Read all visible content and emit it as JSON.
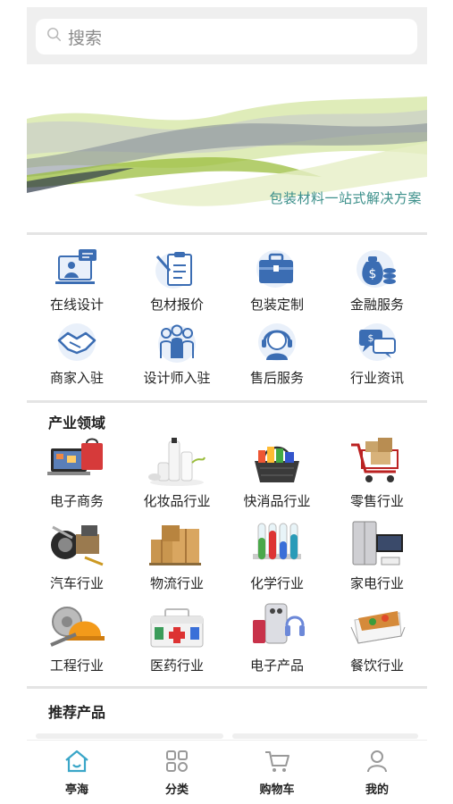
{
  "search": {
    "placeholder": "搜索",
    "icon": "search-icon"
  },
  "banner": {
    "tagline": "包装材料一站式解决方案"
  },
  "services": [
    {
      "label": "在线设计",
      "icon": "online-design-icon"
    },
    {
      "label": "包材报价",
      "icon": "quote-clipboard-icon"
    },
    {
      "label": "包装定制",
      "icon": "briefcase-icon"
    },
    {
      "label": "金融服务",
      "icon": "money-bag-icon"
    },
    {
      "label": "商家入驻",
      "icon": "handshake-icon"
    },
    {
      "label": "设计师入驻",
      "icon": "team-icon"
    },
    {
      "label": "售后服务",
      "icon": "headset-support-icon"
    },
    {
      "label": "行业资讯",
      "icon": "chat-bubbles-icon"
    }
  ],
  "industry": {
    "title": "产业领域",
    "items": [
      {
        "label": "电子商务",
        "icon": "ecommerce-image"
      },
      {
        "label": "化妆品行业",
        "icon": "cosmetics-image"
      },
      {
        "label": "快消品行业",
        "icon": "grocery-basket-image"
      },
      {
        "label": "零售行业",
        "icon": "shopping-cart-image"
      },
      {
        "label": "汽车行业",
        "icon": "auto-parts-image"
      },
      {
        "label": "物流行业",
        "icon": "cardboard-boxes-image"
      },
      {
        "label": "化学行业",
        "icon": "test-tubes-image"
      },
      {
        "label": "家电行业",
        "icon": "refrigerator-image"
      },
      {
        "label": "工程行业",
        "icon": "hard-hat-image"
      },
      {
        "label": "医药行业",
        "icon": "medical-kit-image"
      },
      {
        "label": "电子产品",
        "icon": "electronics-image"
      },
      {
        "label": "餐饮行业",
        "icon": "food-container-image"
      }
    ]
  },
  "recommended": {
    "title": "推荐产品"
  },
  "tabbar": [
    {
      "label": "亭海",
      "icon": "home-icon",
      "active": true
    },
    {
      "label": "分类",
      "icon": "category-grid-icon",
      "active": false
    },
    {
      "label": "购物车",
      "icon": "cart-icon",
      "active": false
    },
    {
      "label": "我的",
      "icon": "profile-icon",
      "active": false
    }
  ],
  "colors": {
    "accent": "#3aa6c8",
    "icon_blue": "#3b6db3",
    "banner_green": "#a9c84a",
    "tagline": "#3b8f8a"
  }
}
